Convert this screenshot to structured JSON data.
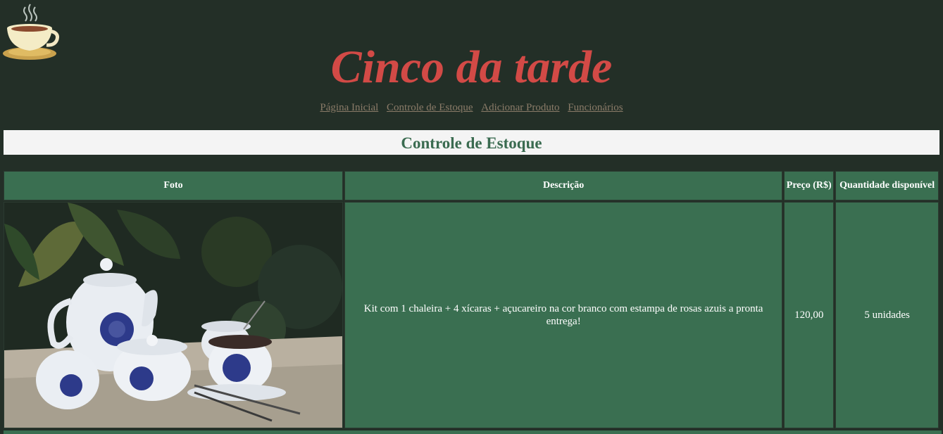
{
  "site": {
    "title": "Cinco da tarde"
  },
  "nav": {
    "items": [
      "Página Inicial",
      "Controle de Estoque",
      "Adicionar Produto",
      "Funcionários"
    ]
  },
  "section": {
    "title": "Controle de Estoque"
  },
  "table": {
    "headers": {
      "photo": "Foto",
      "description": "Descrição",
      "price": "Preço (R$)",
      "quantity": "Quantidade disponível"
    },
    "rows": [
      {
        "description": "Kit com 1 chaleira + 4 xícaras + açucareiro na cor branco com estampa de rosas azuis a pronta entrega!",
        "price": "120,00",
        "quantity": "5 unidades"
      }
    ]
  },
  "colors": {
    "background": "#232f27",
    "title": "#d24a46",
    "table_green": "#3a6f51",
    "section_text": "#3a6b50",
    "nav_link": "#8a7b68"
  },
  "icons": {
    "logo": "teacup-icon"
  }
}
